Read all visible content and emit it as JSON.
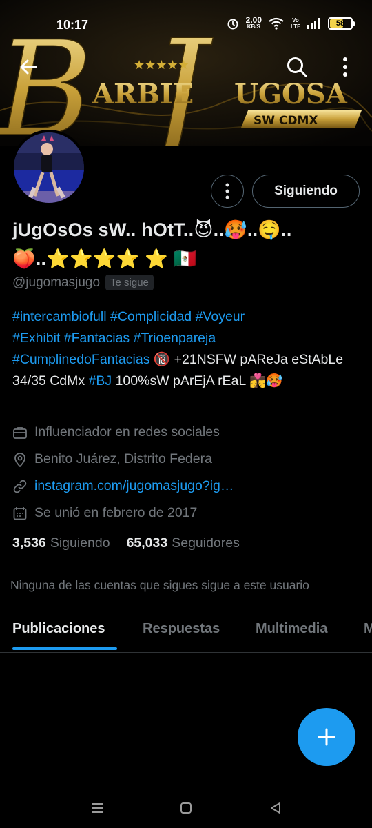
{
  "status_bar": {
    "time": "10:17",
    "net_speed_value": "2.00",
    "net_speed_unit": "KB/S",
    "volte_label": "Vo LTE",
    "battery": "58",
    "battery_level": 0.58
  },
  "banner": {
    "title_left": "ARBIE",
    "title_right": "UGOSA",
    "initial_b": "B",
    "initial_j": "J",
    "subtitle": "SW CDMX",
    "stars": "★★★★★",
    "accent_color": "#d4af37"
  },
  "header": {
    "back_icon": "arrow-left-icon",
    "search_icon": "search-icon",
    "more_icon": "more-vertical-icon"
  },
  "profile": {
    "display_name": "jUgOsOs sW.. hOtT..😈..🥵..🤤..🍑..⭐⭐⭐⭐ ⭐ 🇲🇽",
    "handle": "@jugomasjugo",
    "follows_you": "Te sigue",
    "follow_button": "Siguiendo",
    "bio_tags": [
      "#intercambiofull",
      "#Complicidad",
      "#Voyeur",
      "#Exhibit",
      "#Fantacias",
      "#Trioenpareja",
      "#CumplinedoFantacias"
    ],
    "bio_text_1": " 🔞 +21NSFW pAReJa eStAbLe 34/35 CdMx ",
    "bio_tag_bj": "#BJ",
    "bio_text_2": " 100%sW pArEjA rEaL 👩‍❤️‍💋‍👨🥵",
    "category": "Influenciador en redes sociales",
    "location": "Benito Juárez, Distrito Federa",
    "link": "instagram.com/jugomasjugo?ig…",
    "joined": "Se unió en febrero de 2017",
    "following_count": "3,536",
    "following_label": "Siguiendo",
    "followers_count": "65,033",
    "followers_label": "Seguidores",
    "no_common_followers": "Ninguna de las cuentas que sigues sigue a este usuario"
  },
  "tabs": [
    {
      "label": "Publicaciones",
      "active": true
    },
    {
      "label": "Respuestas",
      "active": false
    },
    {
      "label": "Multimedia",
      "active": false
    },
    {
      "label": "M",
      "active": false
    }
  ],
  "fab_icon": "plus-icon",
  "nav": {
    "recents_icon": "menu-icon",
    "home_icon": "square-icon",
    "back_icon": "triangle-back-icon"
  }
}
